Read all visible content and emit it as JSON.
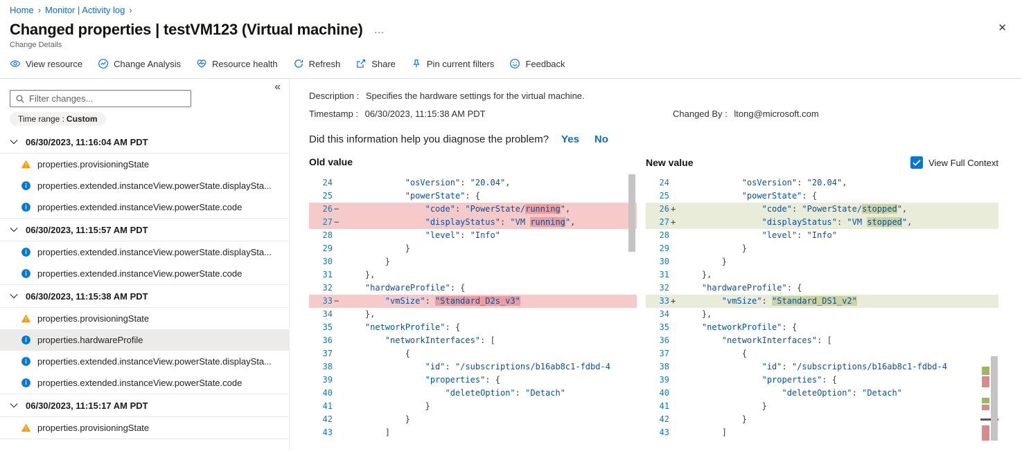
{
  "breadcrumb": {
    "items": [
      {
        "label": "Home"
      },
      {
        "label": "Monitor | Activity log"
      }
    ]
  },
  "header": {
    "title": "Changed properties | testVM123 (Virtual machine)",
    "subtitle": "Change Details",
    "more_glyph": "…",
    "close_glyph": "✕"
  },
  "toolbar": {
    "items": [
      {
        "label": "View resource",
        "icon": "eye-icon"
      },
      {
        "label": "Change Analysis",
        "icon": "change-analysis-icon"
      },
      {
        "label": "Resource health",
        "icon": "heart-pulse-icon"
      },
      {
        "label": "Refresh",
        "icon": "refresh-icon"
      },
      {
        "label": "Share",
        "icon": "share-icon"
      },
      {
        "label": "Pin current filters",
        "icon": "pin-icon"
      },
      {
        "label": "Feedback",
        "icon": "feedback-smiley-icon"
      }
    ]
  },
  "sidebar": {
    "collapse_glyph": "«",
    "filter_placeholder": "Filter changes...",
    "time_range_label": "Time range :",
    "time_range_value": "Custom",
    "groups": [
      {
        "date": "06/30/2023, 11:16:04 AM PDT",
        "items": [
          {
            "icon": "warning",
            "label": "properties.provisioningState",
            "selected": false
          },
          {
            "icon": "info",
            "label": "properties.extended.instanceView.powerState.displaySta...",
            "selected": false
          },
          {
            "icon": "info",
            "label": "properties.extended.instanceView.powerState.code",
            "selected": false
          }
        ]
      },
      {
        "date": "06/30/2023, 11:15:57 AM PDT",
        "items": [
          {
            "icon": "info",
            "label": "properties.extended.instanceView.powerState.displaySta...",
            "selected": false
          },
          {
            "icon": "info",
            "label": "properties.extended.instanceView.powerState.code",
            "selected": false
          }
        ]
      },
      {
        "date": "06/30/2023, 11:15:38 AM PDT",
        "items": [
          {
            "icon": "warning",
            "label": "properties.provisioningState",
            "selected": false
          },
          {
            "icon": "info",
            "label": "properties.hardwareProfile",
            "selected": true
          },
          {
            "icon": "info",
            "label": "properties.extended.instanceView.powerState.displaySta...",
            "selected": false
          },
          {
            "icon": "info",
            "label": "properties.extended.instanceView.powerState.code",
            "selected": false
          }
        ]
      },
      {
        "date": "06/30/2023, 11:15:17 AM PDT",
        "items": [
          {
            "icon": "warning",
            "label": "properties.provisioningState",
            "selected": false
          }
        ]
      }
    ]
  },
  "details": {
    "description_label": "Description :",
    "description": "Specifies the hardware settings for the virtual machine.",
    "timestamp_label": "Timestamp :",
    "timestamp": "06/30/2023, 11:15:38 AM PDT",
    "changed_by_label": "Changed By :",
    "changed_by": "ltong@microsoft.com",
    "question": "Did this information help you diagnose the problem?",
    "yes_label": "Yes",
    "no_label": "No"
  },
  "diff": {
    "old_label": "Old value",
    "new_label": "New value",
    "context_label": "View Full Context",
    "context_checked": true,
    "old_lines": [
      {
        "n": 24,
        "sign": "",
        "kind": "ctx",
        "hl": "",
        "code": "            \"osVersion\": \"20.04\","
      },
      {
        "n": 25,
        "sign": "",
        "kind": "ctx",
        "hl": "",
        "code": "            \"powerState\": {"
      },
      {
        "n": 26,
        "sign": "−",
        "kind": "del",
        "hl": "running",
        "code": "                \"code\": \"PowerState/running\","
      },
      {
        "n": 27,
        "sign": "−",
        "kind": "del",
        "hl": "running",
        "code": "                \"displayStatus\": \"VM running\","
      },
      {
        "n": 28,
        "sign": "",
        "kind": "ctx",
        "hl": "",
        "code": "                \"level\": \"Info\""
      },
      {
        "n": 29,
        "sign": "",
        "kind": "ctx",
        "hl": "",
        "code": "            }"
      },
      {
        "n": 30,
        "sign": "",
        "kind": "ctx",
        "hl": "",
        "code": "        }"
      },
      {
        "n": 31,
        "sign": "",
        "kind": "ctx",
        "hl": "",
        "code": "    },"
      },
      {
        "n": 32,
        "sign": "",
        "kind": "ctx",
        "hl": "",
        "code": "    \"hardwareProfile\": {"
      },
      {
        "n": 33,
        "sign": "−",
        "kind": "del",
        "hl": "\"Standard_D2s_v3\"",
        "code": "        \"vmSize\": \"Standard_D2s_v3\""
      },
      {
        "n": 34,
        "sign": "",
        "kind": "ctx",
        "hl": "",
        "code": "    },"
      },
      {
        "n": 35,
        "sign": "",
        "kind": "ctx",
        "hl": "",
        "code": "    \"networkProfile\": {"
      },
      {
        "n": 36,
        "sign": "",
        "kind": "ctx",
        "hl": "",
        "code": "        \"networkInterfaces\": ["
      },
      {
        "n": 37,
        "sign": "",
        "kind": "ctx",
        "hl": "",
        "code": "            {"
      },
      {
        "n": 38,
        "sign": "",
        "kind": "ctx",
        "hl": "",
        "code": "                \"id\": \"/subscriptions/b16ab8c1-fdbd-4"
      },
      {
        "n": 39,
        "sign": "",
        "kind": "ctx",
        "hl": "",
        "code": "                \"properties\": {"
      },
      {
        "n": 40,
        "sign": "",
        "kind": "ctx",
        "hl": "",
        "code": "                    \"deleteOption\": \"Detach\""
      },
      {
        "n": 41,
        "sign": "",
        "kind": "ctx",
        "hl": "",
        "code": "                }"
      },
      {
        "n": 42,
        "sign": "",
        "kind": "ctx",
        "hl": "",
        "code": "            }"
      },
      {
        "n": 43,
        "sign": "",
        "kind": "ctx",
        "hl": "",
        "code": "        ]"
      }
    ],
    "new_lines": [
      {
        "n": 24,
        "sign": "",
        "kind": "ctx",
        "hl": "",
        "code": "            \"osVersion\": \"20.04\","
      },
      {
        "n": 25,
        "sign": "",
        "kind": "ctx",
        "hl": "",
        "code": "            \"powerState\": {"
      },
      {
        "n": 26,
        "sign": "+",
        "kind": "add",
        "hl": "stopped",
        "code": "                \"code\": \"PowerState/stopped\","
      },
      {
        "n": 27,
        "sign": "+",
        "kind": "add",
        "hl": "stopped",
        "code": "                \"displayStatus\": \"VM stopped\","
      },
      {
        "n": 28,
        "sign": "",
        "kind": "ctx",
        "hl": "",
        "code": "                \"level\": \"Info\""
      },
      {
        "n": 29,
        "sign": "",
        "kind": "ctx",
        "hl": "",
        "code": "            }"
      },
      {
        "n": 30,
        "sign": "",
        "kind": "ctx",
        "hl": "",
        "code": "        }"
      },
      {
        "n": 31,
        "sign": "",
        "kind": "ctx",
        "hl": "",
        "code": "    },"
      },
      {
        "n": 32,
        "sign": "",
        "kind": "ctx",
        "hl": "",
        "code": "    \"hardwareProfile\": {"
      },
      {
        "n": 33,
        "sign": "+",
        "kind": "add",
        "hl": "\"Standard_DS1_v2\"",
        "code": "        \"vmSize\": \"Standard_DS1_v2\""
      },
      {
        "n": 34,
        "sign": "",
        "kind": "ctx",
        "hl": "",
        "code": "    },"
      },
      {
        "n": 35,
        "sign": "",
        "kind": "ctx",
        "hl": "",
        "code": "    \"networkProfile\": {"
      },
      {
        "n": 36,
        "sign": "",
        "kind": "ctx",
        "hl": "",
        "code": "        \"networkInterfaces\": ["
      },
      {
        "n": 37,
        "sign": "",
        "kind": "ctx",
        "hl": "",
        "code": "            {"
      },
      {
        "n": 38,
        "sign": "",
        "kind": "ctx",
        "hl": "",
        "code": "                \"id\": \"/subscriptions/b16ab8c1-fdbd-4"
      },
      {
        "n": 39,
        "sign": "",
        "kind": "ctx",
        "hl": "",
        "code": "                \"properties\": {"
      },
      {
        "n": 40,
        "sign": "",
        "kind": "ctx",
        "hl": "",
        "code": "                    \"deleteOption\": \"Detach\""
      },
      {
        "n": 41,
        "sign": "",
        "kind": "ctx",
        "hl": "",
        "code": "                }"
      },
      {
        "n": 42,
        "sign": "",
        "kind": "ctx",
        "hl": "",
        "code": "            }"
      },
      {
        "n": 43,
        "sign": "",
        "kind": "ctx",
        "hl": "",
        "code": "        ]"
      }
    ]
  },
  "colors": {
    "accent": "#0078d4",
    "link": "#0f6cbd",
    "warning": "#fc9a03",
    "selected_bg": "#edebe9",
    "del_row": "#f7caca",
    "del_word": "#ec9d9d",
    "add_row": "#e9ecd8",
    "add_word": "#ccd3a0",
    "code_string": "#0451a5",
    "line_number": "#1777b8"
  }
}
